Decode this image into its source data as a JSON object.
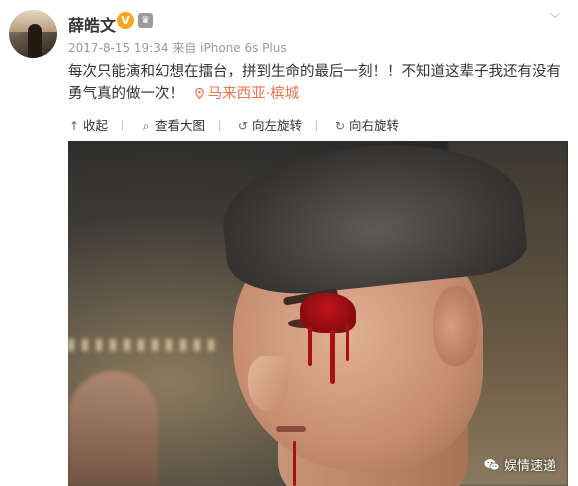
{
  "user": {
    "name": "薛皓文",
    "verified_badge": "V",
    "medal_icon": "crown-icon"
  },
  "post": {
    "time": "2017-8-15 19:34",
    "source": "来自 iPhone 6s Plus",
    "text": "每次只能演和幻想在擂台，拼到生命的最后一刻！！不知道这辈子我还有没有勇气真的做一次！",
    "location": "马来西亚·槟城"
  },
  "toolbar": {
    "collapse": "收起",
    "view_large": "查看大图",
    "rotate_left": "向左旋转",
    "rotate_right": "向右旋转"
  },
  "watermark": {
    "text": "娱情速递"
  },
  "colors": {
    "accent_orange": "#eb7350",
    "verified_badge": "#f5a623",
    "meta_gray": "#999999"
  }
}
